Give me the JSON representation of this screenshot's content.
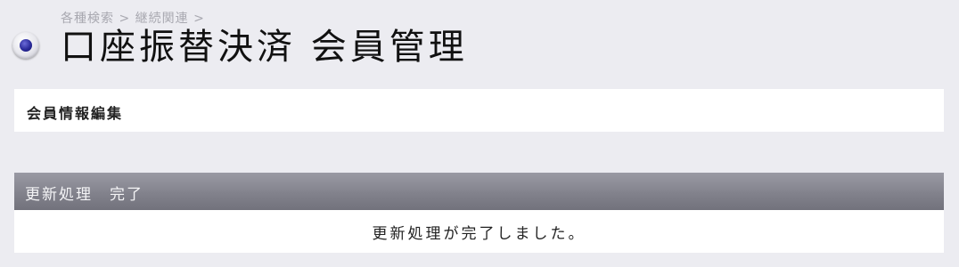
{
  "header": {
    "breadcrumb": "各種検索 > 継続関連 >",
    "title": "口座振替決済 会員管理",
    "bullet_icon": "radio-bullet-icon"
  },
  "edit_panel": {
    "label": "会員情報編集"
  },
  "result": {
    "header_label": "更新処理　完了",
    "message": "更新処理が完了しました。"
  },
  "colors": {
    "background": "#ececf1",
    "panel": "#ffffff",
    "section_header": "#82828c",
    "bullet_accent": "#2a2a9a"
  }
}
